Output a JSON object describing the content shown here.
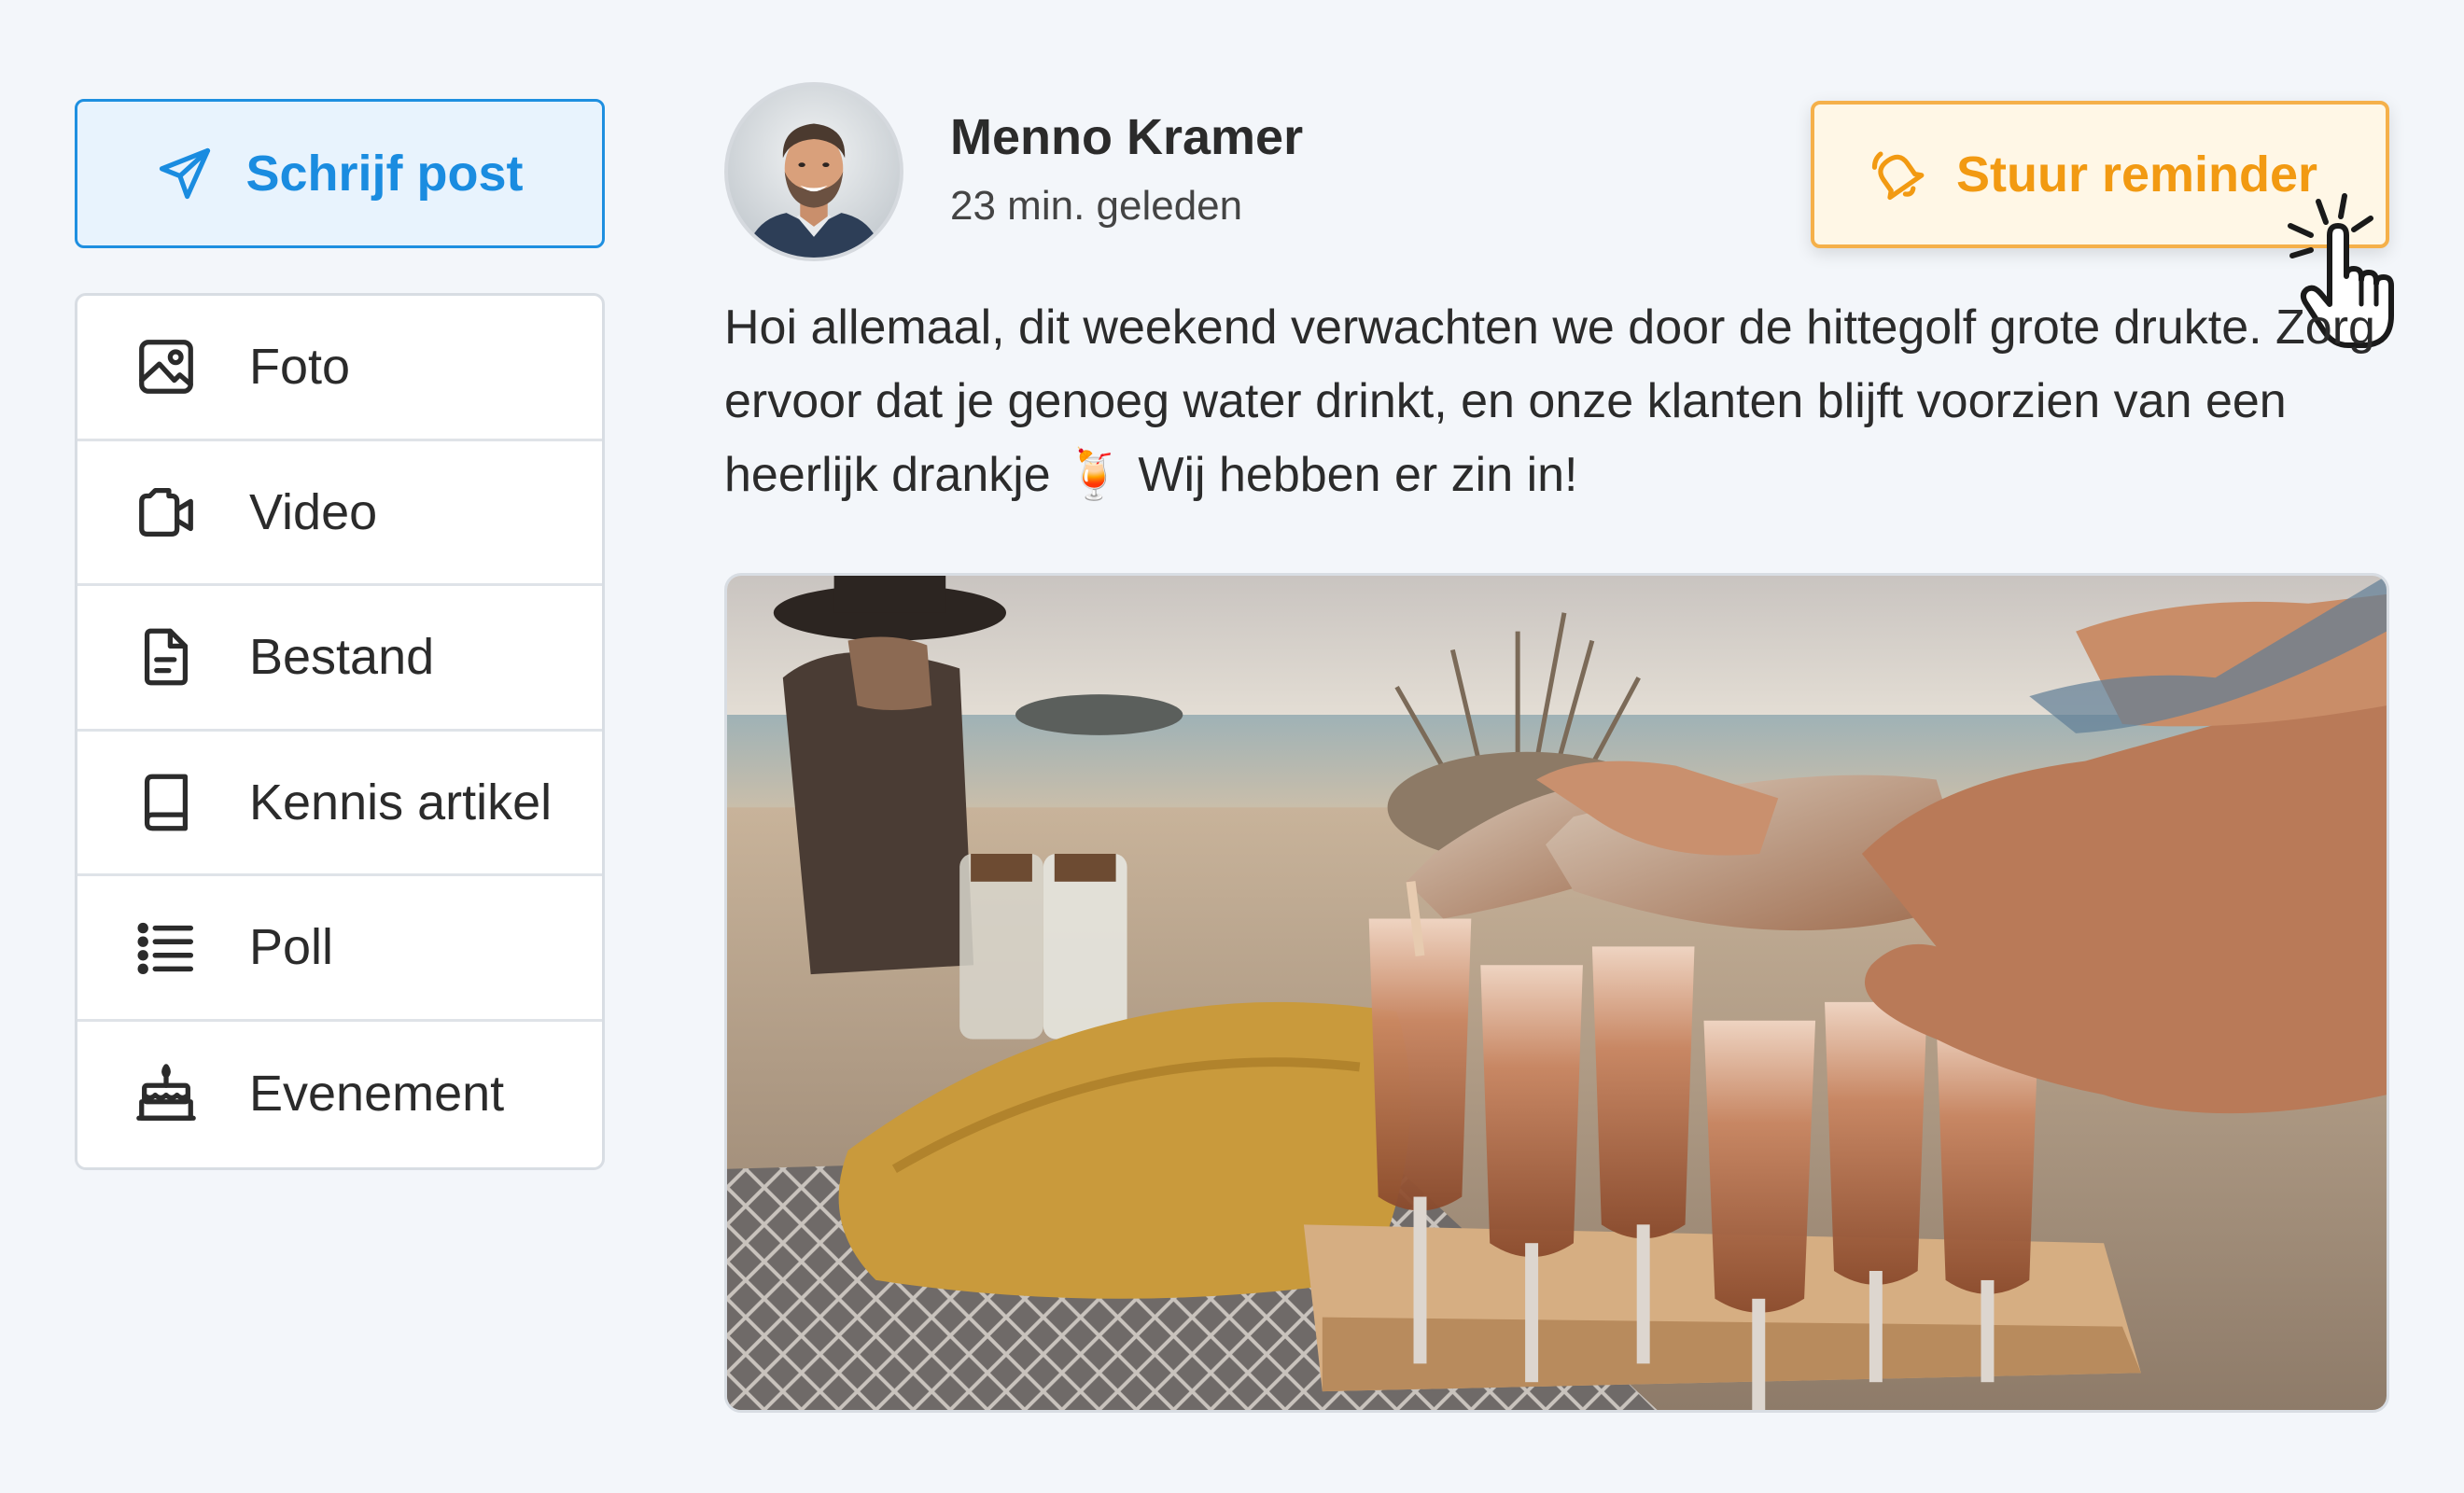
{
  "sidebar": {
    "write_button": {
      "label": "Schrijf post",
      "icon": "paper-plane-icon"
    },
    "items": [
      {
        "label": "Foto",
        "icon": "image-icon"
      },
      {
        "label": "Video",
        "icon": "video-camera-icon"
      },
      {
        "label": "Bestand",
        "icon": "file-icon"
      },
      {
        "label": "Kennis artikel",
        "icon": "book-icon"
      },
      {
        "label": "Poll",
        "icon": "list-icon"
      },
      {
        "label": "Evenement",
        "icon": "cake-icon"
      }
    ]
  },
  "post": {
    "author": "Menno Kramer",
    "timestamp": "23 min. geleden",
    "text": "Hoi allemaal, dit weekend verwachten we door de hittegolf grote drukte. Zorg ervoor dat je genoeg water drinkt, en onze klanten blijft voorzien van een heerlijk drankje 🍹 Wij hebben er zin in!",
    "reminder_button": {
      "label": "Stuur reminder",
      "icon": "bell-icon"
    }
  },
  "colors": {
    "background": "#f3f6fa",
    "primary_blue": "#1a8ce0",
    "primary_blue_bg": "#e8f3fd",
    "accent_orange": "#f29a12",
    "accent_orange_bg": "#fff7e6",
    "border": "#d8dde3"
  }
}
